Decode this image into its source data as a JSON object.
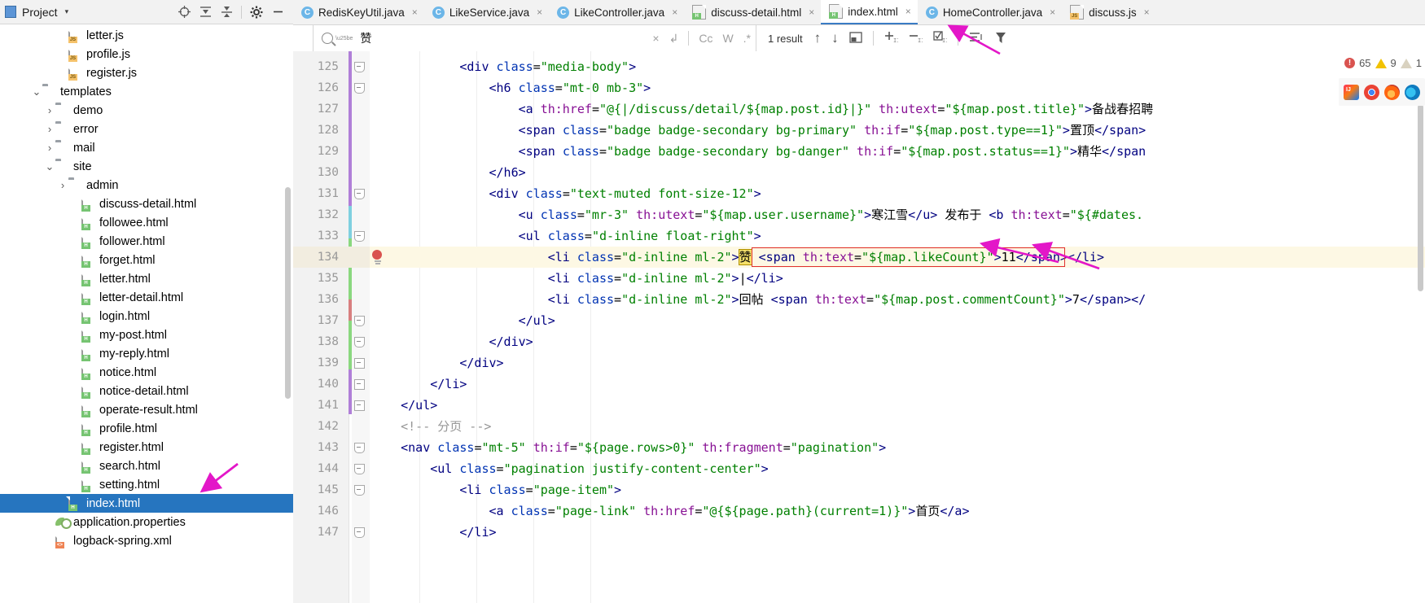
{
  "project_panel": {
    "title": "Project",
    "caret": "▾",
    "toolbar_icons": [
      "locate-icon",
      "expand-all-icon",
      "collapse-all-icon",
      "settings-icon",
      "hide-icon"
    ],
    "tree": [
      {
        "label": "letter.js",
        "indent": 4,
        "type": "js",
        "arrow": "none",
        "selected": false
      },
      {
        "label": "profile.js",
        "indent": 4,
        "type": "js",
        "arrow": "none",
        "selected": false
      },
      {
        "label": "register.js",
        "indent": 4,
        "type": "js",
        "arrow": "none",
        "selected": false
      },
      {
        "label": "templates",
        "indent": 2,
        "type": "folder",
        "arrow": "open",
        "selected": false
      },
      {
        "label": "demo",
        "indent": 3,
        "type": "folder",
        "arrow": "closed",
        "selected": false
      },
      {
        "label": "error",
        "indent": 3,
        "type": "folder",
        "arrow": "closed",
        "selected": false
      },
      {
        "label": "mail",
        "indent": 3,
        "type": "folder",
        "arrow": "closed",
        "selected": false
      },
      {
        "label": "site",
        "indent": 3,
        "type": "folder",
        "arrow": "open",
        "selected": false
      },
      {
        "label": "admin",
        "indent": 4,
        "type": "folder",
        "arrow": "closed",
        "selected": false
      },
      {
        "label": "discuss-detail.html",
        "indent": 5,
        "type": "html",
        "arrow": "none",
        "selected": false
      },
      {
        "label": "followee.html",
        "indent": 5,
        "type": "html",
        "arrow": "none",
        "selected": false
      },
      {
        "label": "follower.html",
        "indent": 5,
        "type": "html",
        "arrow": "none",
        "selected": false
      },
      {
        "label": "forget.html",
        "indent": 5,
        "type": "html",
        "arrow": "none",
        "selected": false
      },
      {
        "label": "letter.html",
        "indent": 5,
        "type": "html",
        "arrow": "none",
        "selected": false
      },
      {
        "label": "letter-detail.html",
        "indent": 5,
        "type": "html",
        "arrow": "none",
        "selected": false
      },
      {
        "label": "login.html",
        "indent": 5,
        "type": "html",
        "arrow": "none",
        "selected": false
      },
      {
        "label": "my-post.html",
        "indent": 5,
        "type": "html",
        "arrow": "none",
        "selected": false
      },
      {
        "label": "my-reply.html",
        "indent": 5,
        "type": "html",
        "arrow": "none",
        "selected": false
      },
      {
        "label": "notice.html",
        "indent": 5,
        "type": "html",
        "arrow": "none",
        "selected": false
      },
      {
        "label": "notice-detail.html",
        "indent": 5,
        "type": "html",
        "arrow": "none",
        "selected": false
      },
      {
        "label": "operate-result.html",
        "indent": 5,
        "type": "html",
        "arrow": "none",
        "selected": false
      },
      {
        "label": "profile.html",
        "indent": 5,
        "type": "html",
        "arrow": "none",
        "selected": false
      },
      {
        "label": "register.html",
        "indent": 5,
        "type": "html",
        "arrow": "none",
        "selected": false
      },
      {
        "label": "search.html",
        "indent": 5,
        "type": "html",
        "arrow": "none",
        "selected": false
      },
      {
        "label": "setting.html",
        "indent": 5,
        "type": "html",
        "arrow": "none",
        "selected": false
      },
      {
        "label": "index.html",
        "indent": 4,
        "type": "html",
        "arrow": "none",
        "selected": true
      },
      {
        "label": "application.properties",
        "indent": 3,
        "type": "properties",
        "arrow": "none",
        "selected": false
      },
      {
        "label": "logback-spring.xml",
        "indent": 3,
        "type": "xml",
        "arrow": "none",
        "selected": false
      }
    ]
  },
  "tabs": [
    {
      "label": "RedisKeyUtil.java",
      "type": "java",
      "active": false,
      "close": "×"
    },
    {
      "label": "LikeService.java",
      "type": "java",
      "active": false,
      "close": "×"
    },
    {
      "label": "LikeController.java",
      "type": "java",
      "active": false,
      "close": "×"
    },
    {
      "label": "discuss-detail.html",
      "type": "html",
      "active": false,
      "close": "×"
    },
    {
      "label": "index.html",
      "type": "html",
      "active": true,
      "close": "×"
    },
    {
      "label": "HomeController.java",
      "type": "java",
      "active": false,
      "close": "×"
    },
    {
      "label": "discuss.js",
      "type": "js",
      "active": false,
      "close": "×"
    }
  ],
  "search": {
    "query": "赞",
    "placeholder": "",
    "clear_label": "×",
    "regex_history_label": "↲",
    "match_case_label": "Cc",
    "words_label": "W",
    "regex_label": ".*",
    "result_count": "1 result",
    "prev_label": "↑",
    "next_label": "↓",
    "select_all_label": "◱",
    "add_line_label": "+",
    "remove_line_label": "−",
    "toggle_label": "☑",
    "filter_list_label": "≡",
    "filter_label": "∇"
  },
  "inspections": {
    "errors": "65",
    "warnings": "9",
    "weak_warnings": "1"
  },
  "browser_icons": [
    "intellij-icon",
    "chrome-icon",
    "firefox-icon",
    "edge-icon"
  ],
  "code": {
    "first_line_number": 125,
    "lines": [
      {
        "num": "125",
        "text": "            <div class=\"media-body\">"
      },
      {
        "num": "126",
        "text": "                <h6 class=\"mt-0 mb-3\">"
      },
      {
        "num": "127",
        "text": "                    <a th:href=\"@{|/discuss/detail/${map.post.id}|}\" th:utext=\"${map.post.title}\">备战春招聘"
      },
      {
        "num": "128",
        "text": "                    <span class=\"badge badge-secondary bg-primary\" th:if=\"${map.post.type==1}\">置顶</span>"
      },
      {
        "num": "129",
        "text": "                    <span class=\"badge badge-secondary bg-danger\" th:if=\"${map.post.status==1}\">精华</span"
      },
      {
        "num": "130",
        "text": "                </h6>"
      },
      {
        "num": "131",
        "text": "                <div class=\"text-muted font-size-12\">"
      },
      {
        "num": "132",
        "text": "                    <u class=\"mr-3\" th:utext=\"${map.user.username}\">寒江雪</u> 发布于 <b th:text=\"${#dates."
      },
      {
        "num": "133",
        "text": "                    <ul class=\"d-inline float-right\">"
      },
      {
        "num": "134",
        "text": "                        <li class=\"d-inline ml-2\">赞 <span th:text=\"${map.likeCount}\">11</span></li>"
      },
      {
        "num": "135",
        "text": "                        <li class=\"d-inline ml-2\">|</li>"
      },
      {
        "num": "136",
        "text": "                        <li class=\"d-inline ml-2\">回帖 <span th:text=\"${map.post.commentCount}\">7</span></"
      },
      {
        "num": "137",
        "text": "                    </ul>"
      },
      {
        "num": "138",
        "text": "                </div>"
      },
      {
        "num": "139",
        "text": "            </div>"
      },
      {
        "num": "140",
        "text": "        </li>"
      },
      {
        "num": "141",
        "text": "    </ul>"
      },
      {
        "num": "142",
        "text": "    <!-- 分页 -->"
      },
      {
        "num": "143",
        "text": "    <nav class=\"mt-5\" th:if=\"${page.rows>0}\" th:fragment=\"pagination\">"
      },
      {
        "num": "144",
        "text": "        <ul class=\"pagination justify-content-center\">"
      },
      {
        "num": "145",
        "text": "            <li class=\"page-item\">"
      },
      {
        "num": "146",
        "text": "                <a class=\"page-link\" th:href=\"@{${page.path}(current=1)}\">首页</a>"
      },
      {
        "num": "147",
        "text": "            </li>"
      }
    ],
    "highlighted_line": "134",
    "search_hit_text": "赞",
    "boxed_expression": "<span th:text=\"${map.likeCount}\">11</span>"
  },
  "colors": {
    "selection_blue": "#2675bf",
    "tag_navy": "#000080",
    "attr_blue": "#0033b3",
    "value_green": "#008000",
    "thymeleaf_purple": "#871094",
    "highlight_yellow": "#f5e06a",
    "box_red": "#e03030",
    "arrow_magenta": "#e317c8",
    "error_red": "#d9534f",
    "warning_yellow": "#f2c200"
  }
}
